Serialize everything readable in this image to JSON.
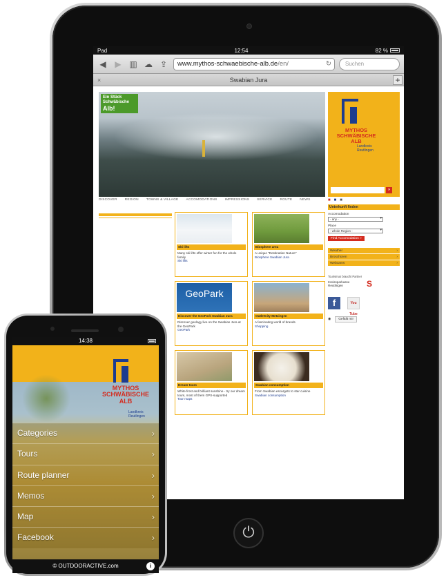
{
  "tablet": {
    "status": {
      "left": "Pad",
      "time": "12:54",
      "battery": "82 %"
    },
    "browser": {
      "url_main": "www.mythos-schwaebische-alb.de",
      "url_path": "/en/",
      "search_placeholder": "Suchen",
      "tab_title": "Swabian Jura",
      "tab_close": "×",
      "tab_add": "+"
    },
    "site": {
      "badge_top": "Ein Stück",
      "badge_mid": "Schwäbische",
      "badge_big": "Alb!",
      "logo_line1": "MYTHOS",
      "logo_line2": "SCHWÄBISCHE",
      "logo_line3": "ALB",
      "logo_sub1": "Landkreis",
      "logo_sub2": "Reutlingen",
      "search_btn": "»",
      "nav": [
        "DISCOVER",
        "REGION",
        "TOWNS & VILLAGE",
        "ACCOMODATIONS",
        "IMPRESSIONS",
        "SERVICE",
        "ROUTE",
        "NEWS"
      ],
      "cards": [
        {
          "title": "Ski lifts",
          "desc": "Many ski lifts offer winter fun for the whole family",
          "link": "Ski lifts",
          "img": ""
        },
        {
          "title": "Biosphere area",
          "desc": "A unique \"Destination Nature\"",
          "link": "Biosphere Swabian Jura",
          "img": ""
        },
        {
          "title": "Discover the GeoPark Swabian Jura",
          "desc": "Discover geology live on the Swabian Jura at the GeoPark",
          "link": "GeoPark",
          "img": "GeoPark"
        },
        {
          "title": "OutletCity Metzingen",
          "desc": "A fascinating world of brands.",
          "link": "Shopping",
          "img": ""
        },
        {
          "title": "Dream tours",
          "desc": "White frost and brilliant sunshine - try our dream tours, most of them GPS-supported",
          "link": "Tour maps",
          "img": ""
        },
        {
          "title": "Swabian consumption",
          "desc": "From Swabian escargots to star cuisine",
          "link": "Swabian consumption",
          "img": ""
        }
      ],
      "right": {
        "head": "Unterkunft finden",
        "acc_label": "Accomodation",
        "acc_value": "- any -",
        "place_label": "Place",
        "place_value": "- whole Region -",
        "find_btn": "Find Accomodation »",
        "list": [
          "Weather",
          "Broschüren",
          "Webcams"
        ],
        "partner": "Tourismus braucht Partner",
        "bank_line1": "Kreissparkasse",
        "bank_line2": "Reutlingen",
        "bank_logo": "S",
        "fb": "f",
        "yt": "You Tube",
        "like": "Gefällt mir"
      }
    },
    "home_symbol": "⏻"
  },
  "phone": {
    "time": "14:38",
    "logo_line1": "MYTHOS",
    "logo_line2": "SCHWÄBISCHE",
    "logo_line3": "ALB",
    "logo_sub1": "Landkreis",
    "logo_sub2": "Reutlingen",
    "menu": [
      "Categories",
      "Tours",
      "Route planner",
      "Memos",
      "Map",
      "Facebook"
    ],
    "footer": "© OUTDOORACTIVE.com",
    "info": "i"
  },
  "colors": {
    "brand_yellow": "#f2b21a",
    "brand_blue": "#1d3c8f",
    "brand_red": "#d42b1e"
  }
}
